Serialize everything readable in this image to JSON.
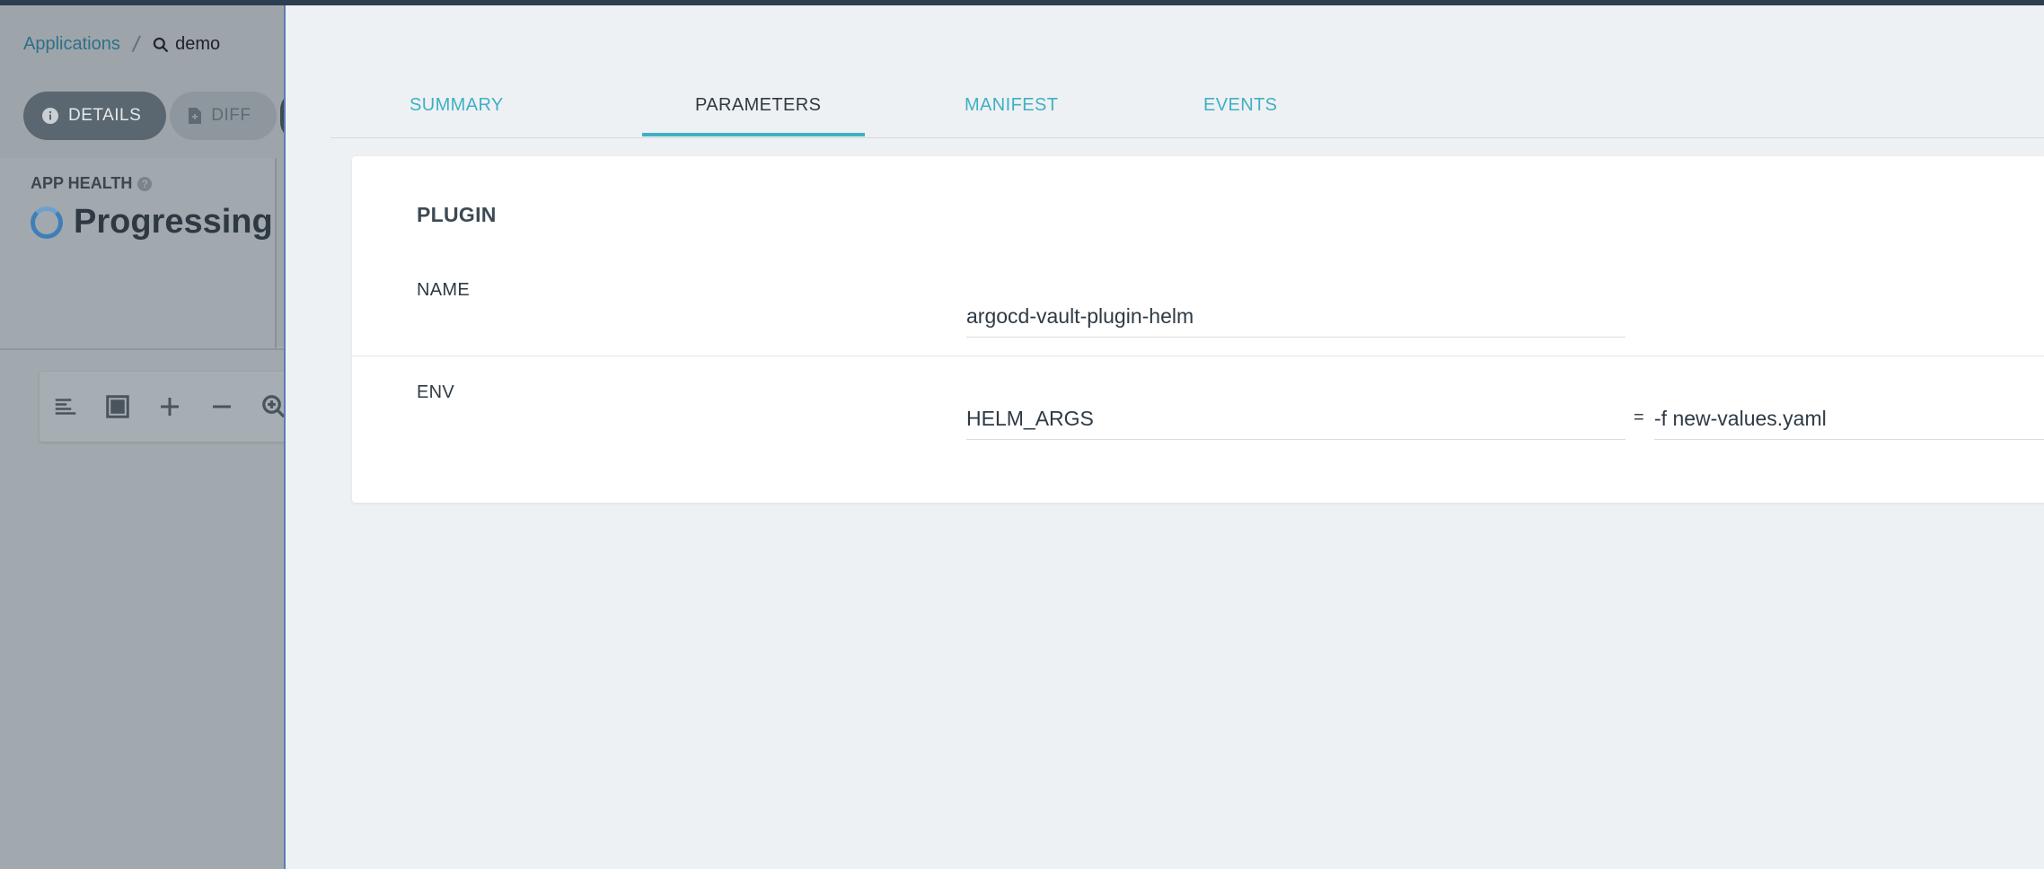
{
  "breadcrumb": {
    "root": "Applications",
    "current": "demo"
  },
  "actions": {
    "details_label": "DETAILS",
    "diff_label": "DIFF"
  },
  "health": {
    "title": "APP HEALTH",
    "status": "Progressing"
  },
  "graph_toolbar": {
    "icons": [
      "list-view-icon",
      "fit-to-screen-icon",
      "zoom-in-plus-icon",
      "zoom-out-minus-icon",
      "zoom-magnifier-icon"
    ]
  },
  "panel": {
    "tabs": [
      {
        "label": "SUMMARY"
      },
      {
        "label": "PARAMETERS"
      },
      {
        "label": "MANIFEST"
      },
      {
        "label": "EVENTS"
      }
    ],
    "active_tab": "PARAMETERS",
    "plugin": {
      "section_title": "PLUGIN",
      "name_label": "NAME",
      "name_value": "argocd-vault-plugin-helm",
      "env_label": "ENV",
      "env_key": "HELM_ARGS",
      "env_separator": "=",
      "env_value": "-f new-values.yaml"
    }
  },
  "colors": {
    "accent": "#3fb0c4",
    "panel_bg": "#eef1f4",
    "overlay": "#a2a9ae",
    "spinner": "#3f7fb8"
  }
}
